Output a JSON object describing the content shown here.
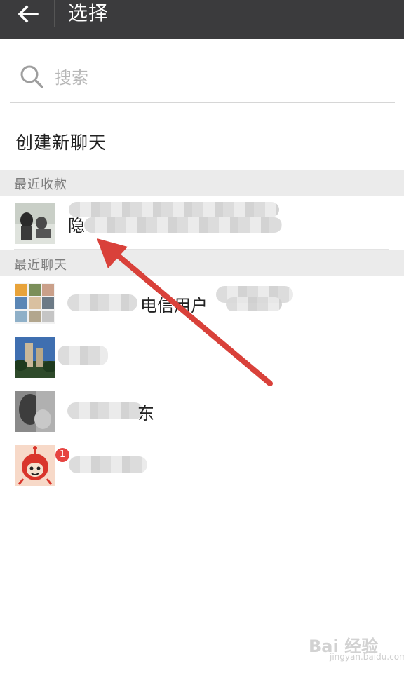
{
  "header": {
    "title": "选择"
  },
  "search": {
    "placeholder": "搜索"
  },
  "new_chat": {
    "label": "创建新聊天"
  },
  "sections": {
    "recent_payments": {
      "title": "最近收款"
    },
    "recent_chats": {
      "title": "最近聊天"
    }
  },
  "contacts": {
    "payment_contact": {
      "visible_name_start": "隐"
    },
    "chat_contacts": [
      {
        "visible_name": "电信用户"
      },
      {
        "visible_name": ""
      },
      {
        "visible_name": "东"
      },
      {
        "visible_name": "",
        "badge": "1"
      }
    ]
  },
  "colors": {
    "topbar": "#3b3b3d",
    "section_background": "#ebebeb",
    "annotation_arrow": "#d9413a",
    "badge": "#e64340"
  },
  "watermark": {
    "brand": "Bai 经验",
    "url": "jingyan.baidu.com"
  }
}
